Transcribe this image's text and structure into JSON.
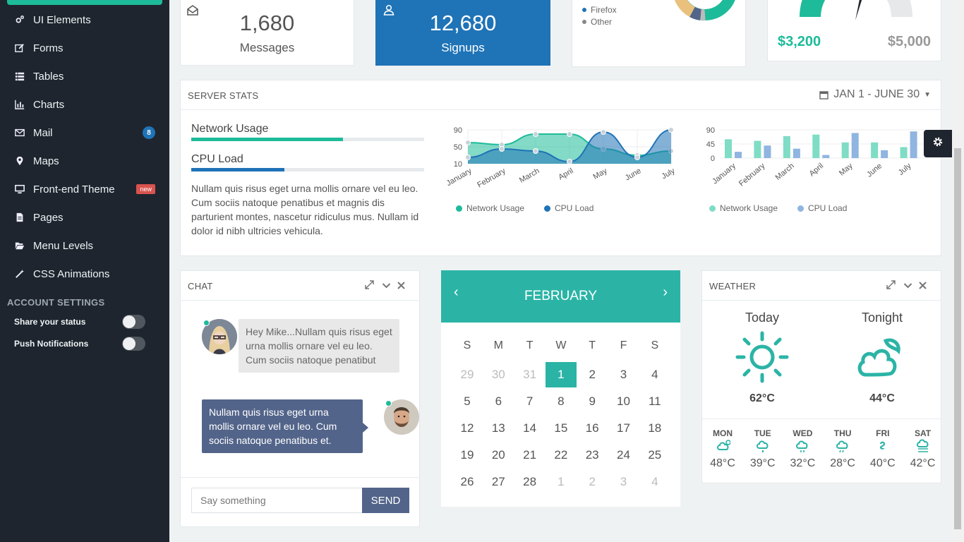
{
  "sidebar": {
    "items": [
      {
        "label": "UI Elements",
        "icon": "cogs-icon"
      },
      {
        "label": "Forms",
        "icon": "edit-icon"
      },
      {
        "label": "Tables",
        "icon": "list-icon"
      },
      {
        "label": "Charts",
        "icon": "bar-chart-icon"
      },
      {
        "label": "Mail",
        "icon": "envelope-icon",
        "badge": "8"
      },
      {
        "label": "Maps",
        "icon": "map-marker-icon"
      },
      {
        "label": "Front-end Theme",
        "icon": "desktop-icon",
        "badge": "new"
      },
      {
        "label": "Pages",
        "icon": "file-icon"
      },
      {
        "label": "Menu Levels",
        "icon": "folder-open-icon"
      },
      {
        "label": "CSS Animations",
        "icon": "magic-icon"
      }
    ],
    "account_heading": "ACCOUNT SETTINGS",
    "toggles": [
      {
        "label": "Share your status",
        "on": false
      },
      {
        "label": "Push Notifications",
        "on": false
      }
    ]
  },
  "stats": {
    "messages": {
      "value": "1,680",
      "label": "Messages"
    },
    "signups": {
      "value": "12,680",
      "label": "Signups"
    },
    "browser_legend": [
      "Firefox",
      "Other"
    ],
    "gauge": {
      "value": "$3,200",
      "max": "$5,000"
    }
  },
  "server_stats": {
    "title": "SERVER STATS",
    "date_range": "JAN 1 - JUNE 30",
    "network_label": "Network Usage",
    "network_percent": 65,
    "cpu_label": "CPU Load",
    "cpu_percent": 40,
    "description": "Nullam quis risus eget urna mollis ornare vel eu leo. Cum sociis natoque penatibus et magnis dis parturient montes, nascetur ridiculus mus. Nullam id dolor id nibh ultricies vehicula."
  },
  "chart_data": [
    {
      "type": "area",
      "categories": [
        "January",
        "February",
        "March",
        "April",
        "May",
        "June",
        "July"
      ],
      "series": [
        {
          "name": "Network Usage",
          "values": [
            60,
            55,
            80,
            80,
            45,
            30,
            40
          ]
        },
        {
          "name": "CPU Load",
          "values": [
            25,
            45,
            40,
            15,
            85,
            25,
            90
          ]
        }
      ],
      "yticks": [
        10,
        50,
        90
      ],
      "ylim": [
        10,
        90
      ],
      "legend": "bottom"
    },
    {
      "type": "bar",
      "categories": [
        "January",
        "February",
        "March",
        "April",
        "May",
        "June",
        "July"
      ],
      "series": [
        {
          "name": "Network Usage",
          "values": [
            60,
            55,
            70,
            75,
            50,
            50,
            35
          ]
        },
        {
          "name": "CPU Load",
          "values": [
            20,
            40,
            30,
            10,
            80,
            25,
            85
          ]
        }
      ],
      "yticks": [
        0,
        45,
        90
      ],
      "ylim": [
        0,
        90
      ],
      "legend": "bottom"
    }
  ],
  "chat": {
    "title": "CHAT",
    "messages": [
      {
        "from": "them",
        "text": "Hey Mike...Nullam quis risus eget urna mollis ornare vel eu leo. Cum sociis natoque penatibut"
      },
      {
        "from": "me",
        "text": "Nullam quis risus eget urna mollis ornare vel eu leo. Cum sociis natoque penatibus et."
      }
    ],
    "input_placeholder": "Say something",
    "send_label": "SEND"
  },
  "calendar": {
    "month": "FEBRUARY",
    "dow": [
      "S",
      "M",
      "T",
      "W",
      "T",
      "F",
      "S"
    ],
    "weeks": [
      [
        "29",
        "30",
        "31",
        "1",
        "2",
        "3",
        "4"
      ],
      [
        "5",
        "6",
        "7",
        "8",
        "9",
        "10",
        "11"
      ],
      [
        "12",
        "13",
        "14",
        "15",
        "16",
        "17",
        "18"
      ],
      [
        "19",
        "20",
        "21",
        "22",
        "23",
        "24",
        "25"
      ],
      [
        "26",
        "27",
        "28",
        "1",
        "2",
        "3",
        "4"
      ]
    ],
    "selected": "1"
  },
  "weather": {
    "title": "WEATHER",
    "today": {
      "label": "Today",
      "temp": "62°C"
    },
    "tonight": {
      "label": "Tonight",
      "temp": "44°C"
    },
    "forecast": [
      {
        "day": "MON",
        "temp": "48°C"
      },
      {
        "day": "TUE",
        "temp": "39°C"
      },
      {
        "day": "WED",
        "temp": "32°C"
      },
      {
        "day": "THU",
        "temp": "28°C"
      },
      {
        "day": "FRI",
        "temp": "40°C"
      },
      {
        "day": "SAT",
        "temp": "42°C"
      }
    ]
  },
  "colors": {
    "accent": "#1dbb99",
    "blue": "#1f73b7",
    "sidebar": "#1f252e"
  }
}
